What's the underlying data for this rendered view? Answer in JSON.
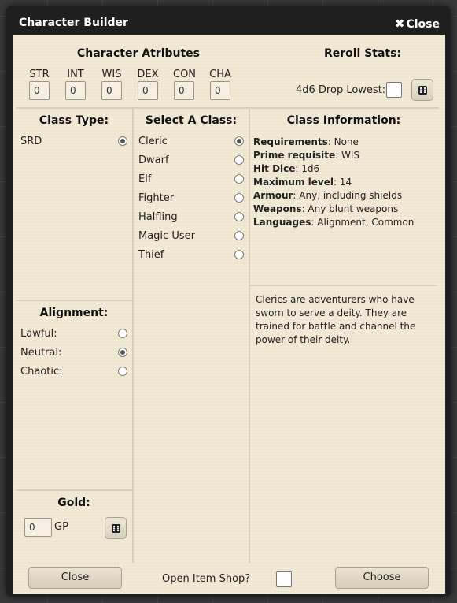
{
  "window": {
    "title": "Character Builder",
    "close_label": "Close"
  },
  "attributes": {
    "heading": "Character Atributes",
    "stats": [
      {
        "label": "STR",
        "value": "0"
      },
      {
        "label": "INT",
        "value": "0"
      },
      {
        "label": "WIS",
        "value": "0"
      },
      {
        "label": "DEX",
        "value": "0"
      },
      {
        "label": "CON",
        "value": "0"
      },
      {
        "label": "CHA",
        "value": "0"
      }
    ]
  },
  "reroll": {
    "heading": "Reroll Stats:",
    "option_label": "4d6 Drop Lowest:",
    "checked": false,
    "icon": "dice-icon"
  },
  "class_type": {
    "heading": "Class Type:",
    "options": [
      {
        "label": "SRD",
        "checked": true
      }
    ]
  },
  "select_class": {
    "heading": "Select A Class:",
    "options": [
      {
        "label": "Cleric",
        "checked": true
      },
      {
        "label": "Dwarf",
        "checked": false
      },
      {
        "label": "Elf",
        "checked": false
      },
      {
        "label": "Fighter",
        "checked": false
      },
      {
        "label": "Halfling",
        "checked": false
      },
      {
        "label": "Magic User",
        "checked": false
      },
      {
        "label": "Thief",
        "checked": false
      }
    ]
  },
  "class_info": {
    "heading": "Class Information:",
    "rows": [
      {
        "key": "Requirements",
        "value": ": None"
      },
      {
        "key": "Prime requisite",
        "value": ": WIS"
      },
      {
        "key": "Hit Dice",
        "value": ": 1d6"
      },
      {
        "key": "Maximum level",
        "value": ": 14"
      },
      {
        "key": "Armour",
        "value": ": Any, including shields"
      },
      {
        "key": "Weapons",
        "value": ": Any blunt weapons"
      },
      {
        "key": "Languages",
        "value": ": Alignment, Common"
      }
    ],
    "description": "Clerics are adventurers who have sworn to serve a deity. They are trained for battle and channel the power of their deity."
  },
  "alignment": {
    "heading": "Alignment:",
    "options": [
      {
        "label": "Lawful:",
        "checked": false
      },
      {
        "label": "Neutral:",
        "checked": true
      },
      {
        "label": "Chaotic:",
        "checked": false
      }
    ]
  },
  "gold": {
    "heading": "Gold:",
    "value": "0",
    "unit": "GP",
    "icon": "dice-icon"
  },
  "footer": {
    "close_label": "Close",
    "shop_label": "Open Item Shop?",
    "shop_checked": false,
    "choose_label": "Choose"
  }
}
